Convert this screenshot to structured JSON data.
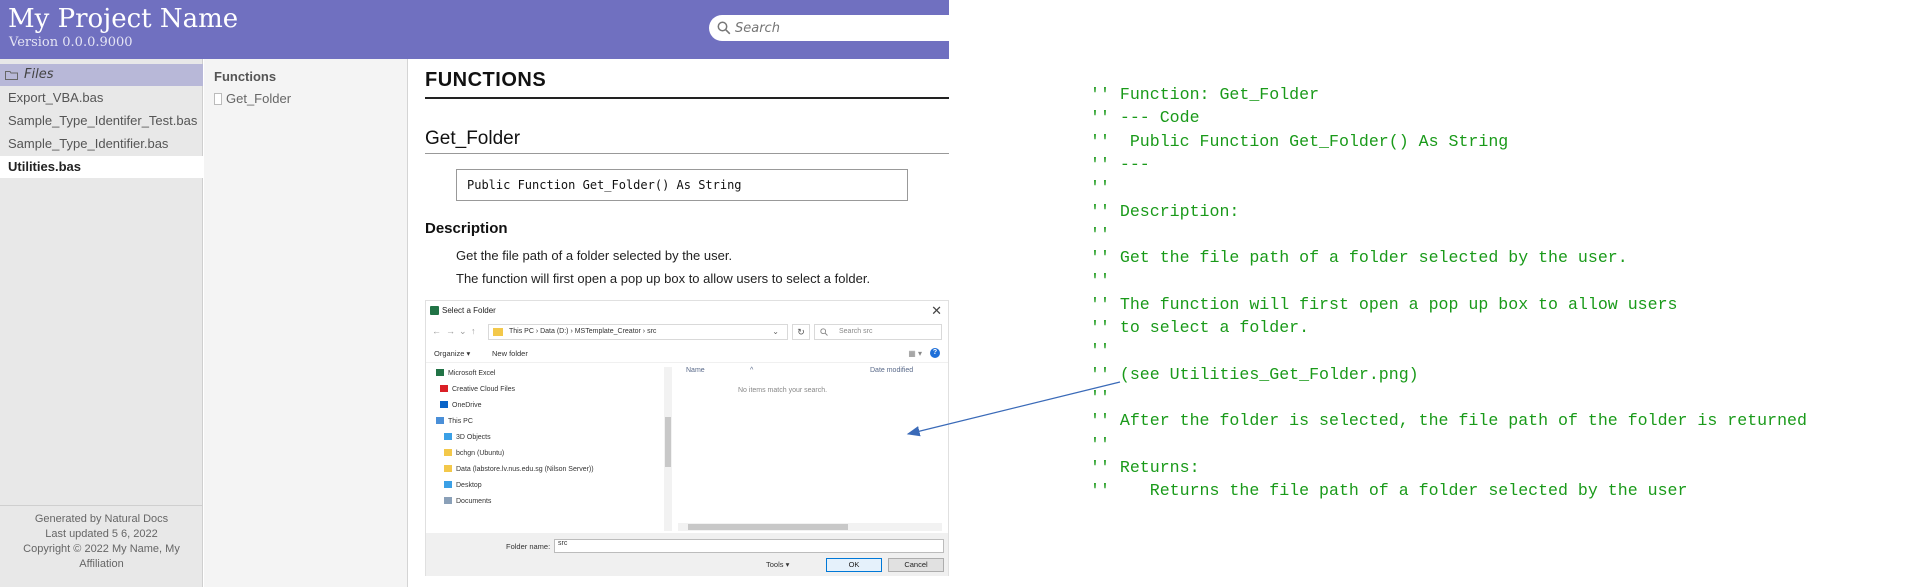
{
  "header": {
    "project_title": "My Project Name",
    "version": "Version 0.0.0.9000",
    "search_placeholder": "Search"
  },
  "menu": {
    "section_label": "Files",
    "items": [
      {
        "label": "Export_VBA.bas",
        "selected": false
      },
      {
        "label": "Sample_Type_Identifer_Test.bas",
        "selected": false
      },
      {
        "label": "Sample_Type_Identifier.bas",
        "selected": false
      },
      {
        "label": "Utilities.bas",
        "selected": true
      }
    ],
    "footer": {
      "generated_by": "Generated by Natural Docs",
      "last_updated": "Last updated 5 6, 2022",
      "copyright_line1": "Copyright © 2022 My Name, My",
      "copyright_line2": "Affiliation"
    }
  },
  "summary": {
    "title": "Functions",
    "entries": [
      {
        "label": "Get_Folder"
      }
    ]
  },
  "content": {
    "heading": "FUNCTIONS",
    "function_title": "Get_Folder",
    "prototype": "Public Function Get_Folder() As String",
    "description_heading": "Description",
    "description_paragraphs": [
      "Get the file path of a folder selected by the user.",
      "The function will first open a pop up box to allow users to select a folder."
    ]
  },
  "dialog": {
    "title": "Select a Folder",
    "close_glyph": "✕",
    "address_path": "This PC  ›  Data (D:)  ›  MSTemplate_Creator  ›  src",
    "refresh_glyph": "↻",
    "search_placeholder": "Search src",
    "toolbar": {
      "organize": "Organize ▾",
      "new_folder": "New folder",
      "help": "?"
    },
    "nav_items": [
      {
        "label": "Microsoft Excel",
        "icon": "excel-icon",
        "color": "#217346"
      },
      {
        "label": "Creative Cloud Files",
        "icon": "creative-cloud-icon",
        "color": "#da1f26"
      },
      {
        "label": "OneDrive",
        "icon": "onedrive-icon",
        "color": "#0a64c8"
      },
      {
        "label": "This PC",
        "icon": "computer-icon",
        "color": "#4a8fd8"
      },
      {
        "label": "3D Objects",
        "icon": "3d-objects-icon",
        "color": "#3ba0e6"
      },
      {
        "label": "bchgn (Ubuntu)",
        "icon": "network-folder-icon",
        "color": "#f3c84a"
      },
      {
        "label": "Data (labstore.lv.nus.edu.sg (Nilson Server))",
        "icon": "network-drive-icon",
        "color": "#f3c84a"
      },
      {
        "label": "Desktop",
        "icon": "desktop-icon",
        "color": "#3ba0e6"
      },
      {
        "label": "Documents",
        "icon": "documents-icon",
        "color": "#8aa0b8"
      }
    ],
    "columns": {
      "name": "Name",
      "date_modified": "Date modified"
    },
    "empty_message": "No items match your search.",
    "folder_name_label": "Folder name:",
    "folder_name_value": "src",
    "tools_label": "Tools  ▾",
    "ok_label": "OK",
    "cancel_label": "Cancel"
  },
  "source_comment": {
    "lines": [
      "'' Function: Get_Folder",
      "'' --- Code",
      "''  Public Function Get_Folder() As String",
      "'' ---",
      "''",
      "'' Description:",
      "''",
      "'' Get the file path of a folder selected by the user.",
      "''",
      "'' The function will first open a pop up box to allow users",
      "'' to select a folder.",
      "''",
      "'' (see Utilities_Get_Folder.png)",
      "''",
      "'' After the folder is selected, the file path of the folder is returned",
      "''",
      "'' Returns:",
      "''    Returns the file path of a folder selected by the user"
    ],
    "color": "#1a9a1a"
  },
  "colors": {
    "header_bg": "#7070c0",
    "menu_bg": "#e8e8e8",
    "arrow": "#3a6ab8"
  }
}
